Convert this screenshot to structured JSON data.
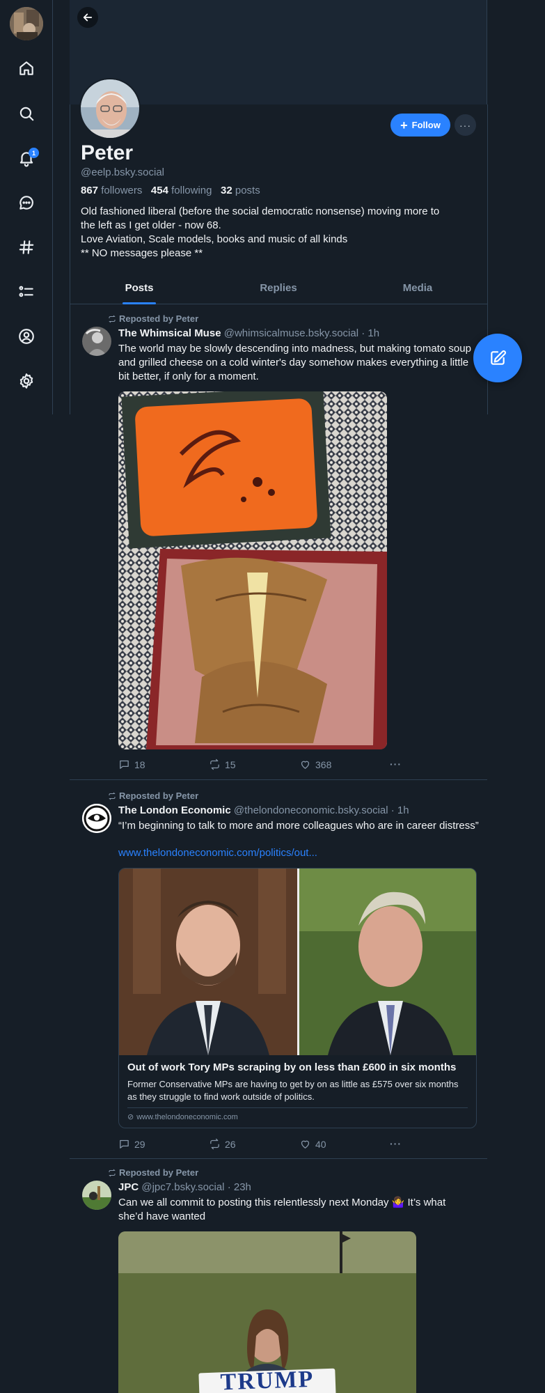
{
  "profile": {
    "name": "Peter",
    "handle": "@eelp.bsky.social",
    "followers_count": "867",
    "followers_label": "followers",
    "following_count": "454",
    "following_label": "following",
    "posts_count": "32",
    "posts_label": "posts",
    "bio": [
      "Old fashioned liberal (before the social democratic nonsense) moving more to",
      "the left as I get older - now 68.",
      "Love Aviation, Scale models, books and music of all kinds",
      "** NO messages please **"
    ],
    "follow_label": "Follow"
  },
  "nav": {
    "notification_count": "1",
    "icons": [
      "home-icon",
      "search-icon",
      "bell-icon",
      "chat-icon",
      "hashtag-icon",
      "list-icon",
      "profile-icon",
      "settings-icon"
    ]
  },
  "tabs": [
    "Posts",
    "Replies",
    "Media"
  ],
  "posts": [
    {
      "repost": "Reposted by Peter",
      "author": "The Whimsical Muse",
      "handle": "@whimsicalmuse.bsky.social",
      "time": "· 1h",
      "text": "The world may be slowly descending into madness, but making tomato soup and grilled cheese on a cold winter's day somehow makes everything a little bit better, if only for a moment.",
      "replies": "18",
      "reposts": "15",
      "likes": "368"
    },
    {
      "repost": "Reposted by Peter",
      "author": "The London Economic",
      "handle": "@thelondoneconomic.bsky.social",
      "time": "· 1h",
      "text": "“I’m beginning to talk to more and more colleagues who are in career distress”",
      "link": "www.thelondoneconomic.com/politics/out...",
      "card": {
        "title": "Out of work Tory MPs scraping by on less than £600 in six months",
        "description": "Former Conservative MPs are having to get by on as little as £575 over six months as they struggle to find work outside of politics.",
        "domain": "www.thelondoneconomic.com"
      },
      "replies": "29",
      "reposts": "26",
      "likes": "40"
    },
    {
      "repost": "Reposted by Peter",
      "author": "JPC",
      "handle": "@jpc7.bsky.social",
      "time": "· 23h",
      "text": "Can we all commit to posting this relentlessly next Monday 🤷‍♀️ It’s what she’d have wanted",
      "sign_text": "TRUMP"
    }
  ],
  "colors": {
    "background": "#161e27",
    "accent": "#2a82ff",
    "border": "#2e4052",
    "muted_text": "#8696a8"
  }
}
